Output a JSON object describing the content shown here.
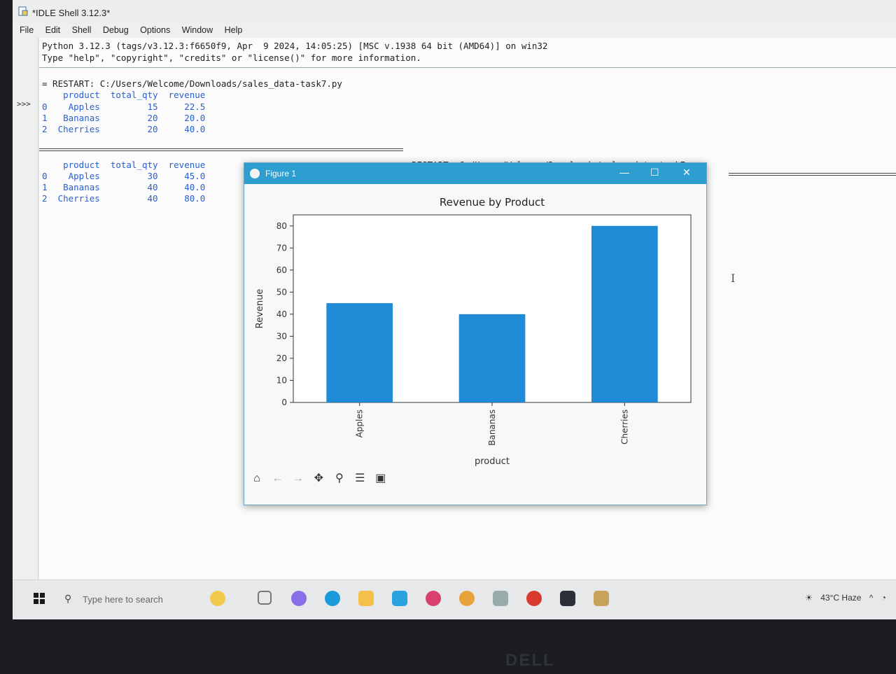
{
  "window": {
    "title": "*IDLE Shell 3.12.3*"
  },
  "menu": [
    "File",
    "Edit",
    "Shell",
    "Debug",
    "Options",
    "Window",
    "Help"
  ],
  "shell": {
    "banner1": "Python 3.12.3 (tags/v3.12.3:f6650f9, Apr  9 2024, 14:05:25) [MSC v.1938 64 bit (AMD64)] on win32",
    "banner2": "Type \"help\", \"copyright\", \"credits\" or \"license()\" for more information.",
    "prompt": ">>>",
    "restart1": "= RESTART: C:/Users/Welcome/Downloads/sales_data-task7.py",
    "restart2": "RESTART: C:/Users/Welcome/Downloads/sales_data-task7.py",
    "table1_header": "    product  total_qty  revenue",
    "table1_rows": [
      "0    Apples         15     22.5",
      "1   Bananas         20     20.0",
      "2  Cherries         20     40.0"
    ],
    "table2_header": "    product  total_qty  revenue",
    "table2_rows": [
      "0    Apples         30     45.0",
      "1   Bananas         40     40.0",
      "2  Cherries         40     80.0"
    ]
  },
  "figure": {
    "title": "Figure 1",
    "min": "—",
    "max": "☐",
    "close": "✕",
    "toolbar": [
      "home-icon",
      "back-icon",
      "forward-icon",
      "pan-icon",
      "zoom-icon",
      "configure-icon",
      "save-icon"
    ]
  },
  "chart_data": {
    "type": "bar",
    "title": "Revenue by Product",
    "xlabel": "product",
    "ylabel": "Revenue",
    "categories": [
      "Apples",
      "Bananas",
      "Cherries"
    ],
    "values": [
      45.0,
      40.0,
      80.0
    ],
    "ylim": [
      0,
      85
    ],
    "yticks": [
      0,
      10,
      20,
      30,
      40,
      50,
      60,
      70,
      80
    ],
    "bar_color": "#1f8ad6",
    "grid": false
  },
  "taskbar": {
    "search_placeholder": "Type here to search",
    "weather": "43°C  Haze",
    "chevron": "^"
  },
  "bezel": "DELL"
}
